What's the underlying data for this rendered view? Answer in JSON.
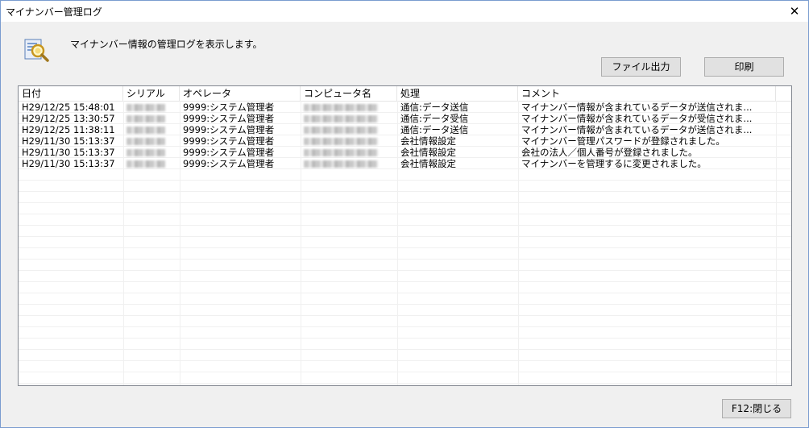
{
  "window": {
    "title": "マイナンバー管理ログ",
    "close_glyph": "✕"
  },
  "header": {
    "icon": "log-search-icon",
    "message": "マイナンバー情報の管理ログを表示します。"
  },
  "toolbar": {
    "file_output_label": "ファイル出力",
    "print_label": "印刷"
  },
  "table": {
    "columns": [
      "日付",
      "シリアル",
      "オペレータ",
      "コンピュータ名",
      "処理",
      "コメント"
    ],
    "rows": [
      {
        "date": "H29/12/25 15:48:01",
        "serial": "",
        "operator": "9999:システム管理者",
        "computer": "",
        "process": "通信:データ送信",
        "comment": "マイナンバー情報が含まれているデータが送信されま..."
      },
      {
        "date": "H29/12/25 13:30:57",
        "serial": "",
        "operator": "9999:システム管理者",
        "computer": "",
        "process": "通信:データ受信",
        "comment": "マイナンバー情報が含まれているデータが受信されま..."
      },
      {
        "date": "H29/12/25 11:38:11",
        "serial": "",
        "operator": "9999:システム管理者",
        "computer": "",
        "process": "通信:データ送信",
        "comment": "マイナンバー情報が含まれているデータが送信されま..."
      },
      {
        "date": "H29/11/30 15:13:37",
        "serial": "",
        "operator": "9999:システム管理者",
        "computer": "",
        "process": "会社情報設定",
        "comment": "マイナンバー管理パスワードが登録されました。"
      },
      {
        "date": "H29/11/30 15:13:37",
        "serial": "",
        "operator": "9999:システム管理者",
        "computer": "",
        "process": "会社情報設定",
        "comment": "会社の法人／個人番号が登録されました。"
      },
      {
        "date": "H29/11/30 15:13:37",
        "serial": "",
        "operator": "9999:システム管理者",
        "computer": "",
        "process": "会社情報設定",
        "comment": "マイナンバーを管理するに変更されました。"
      }
    ]
  },
  "footer": {
    "close_label": "F12:閉じる"
  }
}
